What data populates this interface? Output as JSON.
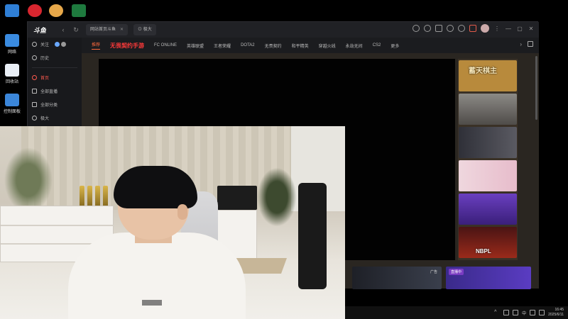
{
  "desktop": {
    "icons": [
      {
        "label": "",
        "color": "#2f7fd6",
        "icon": "computer-icon"
      },
      {
        "label": "网络",
        "color": "#3a8be0",
        "icon": "network-icon"
      },
      {
        "label": "回收站",
        "color": "#e9eef5",
        "icon": "recycle-bin-icon"
      },
      {
        "label": "控制面板",
        "color": "#3b86d9",
        "icon": "control-panel-icon"
      },
      {
        "label": "",
        "color": "#d8262f",
        "icon": "app-red-icon"
      },
      {
        "label": "",
        "color": "#e7a84a",
        "icon": "app-character-icon"
      },
      {
        "label": "",
        "color": "#1e7a3e",
        "icon": "excel-icon"
      }
    ]
  },
  "app": {
    "logo_text": "斗鱼",
    "tabs": [
      {
        "label": "网站首页斗鱼",
        "close": "✕"
      },
      {
        "label": "⊙ 极大",
        "close": ""
      }
    ],
    "nav": {
      "back": "‹",
      "refresh": "↻"
    },
    "window_controls": {
      "minimize": "—",
      "maximize": "▢",
      "close": "✕"
    },
    "sidebar": {
      "items": [
        {
          "label": "关注",
          "icon": "heart-icon",
          "active": false
        },
        {
          "label": "历史",
          "icon": "history-icon",
          "active": false
        },
        {
          "label": "首页",
          "icon": "home-icon",
          "active": true
        },
        {
          "label": "全部直播",
          "icon": "live-icon",
          "active": false
        },
        {
          "label": "全部分类",
          "icon": "grid-icon",
          "active": false
        },
        {
          "label": "极大",
          "icon": "compass-icon",
          "active": false
        }
      ]
    },
    "categories": [
      {
        "label": "推荐",
        "selected": true,
        "promo": false
      },
      {
        "label": "无畏契约手游",
        "selected": false,
        "promo": true
      },
      {
        "label": "FC ONLINE",
        "selected": false,
        "promo": false
      },
      {
        "label": "英雄联盟",
        "selected": false,
        "promo": false
      },
      {
        "label": "王者荣耀",
        "selected": false,
        "promo": false
      },
      {
        "label": "DOTA2",
        "selected": false,
        "promo": false
      },
      {
        "label": "无畏契约",
        "selected": false,
        "promo": false
      },
      {
        "label": "和平精英",
        "selected": false,
        "promo": false
      },
      {
        "label": "穿越火线",
        "selected": false,
        "promo": false
      },
      {
        "label": "永劫无间",
        "selected": false,
        "promo": false
      },
      {
        "label": "CS2",
        "selected": false,
        "promo": false
      },
      {
        "label": "更多",
        "selected": false,
        "promo": false
      }
    ],
    "thumbnails": [
      {
        "text": "蓄天棋主",
        "bg": "#b88a3c"
      },
      {
        "text": "",
        "bg": "#6e6a66"
      },
      {
        "text": "",
        "bg": "#46464c"
      },
      {
        "text": "",
        "bg": "#ecc9d4"
      },
      {
        "text": "",
        "bg": "#5b2f9a"
      },
      {
        "text": "NBPL",
        "bg": "#7a1a1a"
      }
    ],
    "bottom_cards": [
      {
        "badge": "",
        "tag": "广告",
        "bg": "#262a33"
      },
      {
        "badge": "直播中",
        "tag": "",
        "bg": "#3a2a8a"
      }
    ]
  },
  "taskbar": {
    "tray_text": "中",
    "time": "16:45",
    "date": "2025/6/11"
  }
}
